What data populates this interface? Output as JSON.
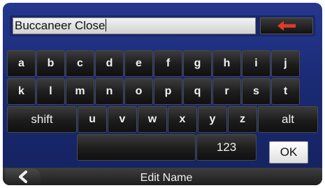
{
  "input": {
    "value": "Buccaneer Close"
  },
  "keys": {
    "row1": [
      "a",
      "b",
      "c",
      "d",
      "e",
      "f",
      "g",
      "h",
      "i",
      "j"
    ],
    "row2": [
      "k",
      "l",
      "m",
      "n",
      "o",
      "p",
      "q",
      "r",
      "s",
      "t"
    ],
    "row3": [
      "shift",
      "u",
      "v",
      "w",
      "x",
      "y",
      "z",
      "alt"
    ],
    "numbers_label": "123"
  },
  "ok_label": "OK",
  "title": "Edit Name",
  "colors": {
    "backspace_arrow": "#e23a2a",
    "screen_bg": "#1f2f80"
  },
  "icons": {
    "backspace": "left-arrow-icon",
    "back": "chevron-left-icon"
  }
}
